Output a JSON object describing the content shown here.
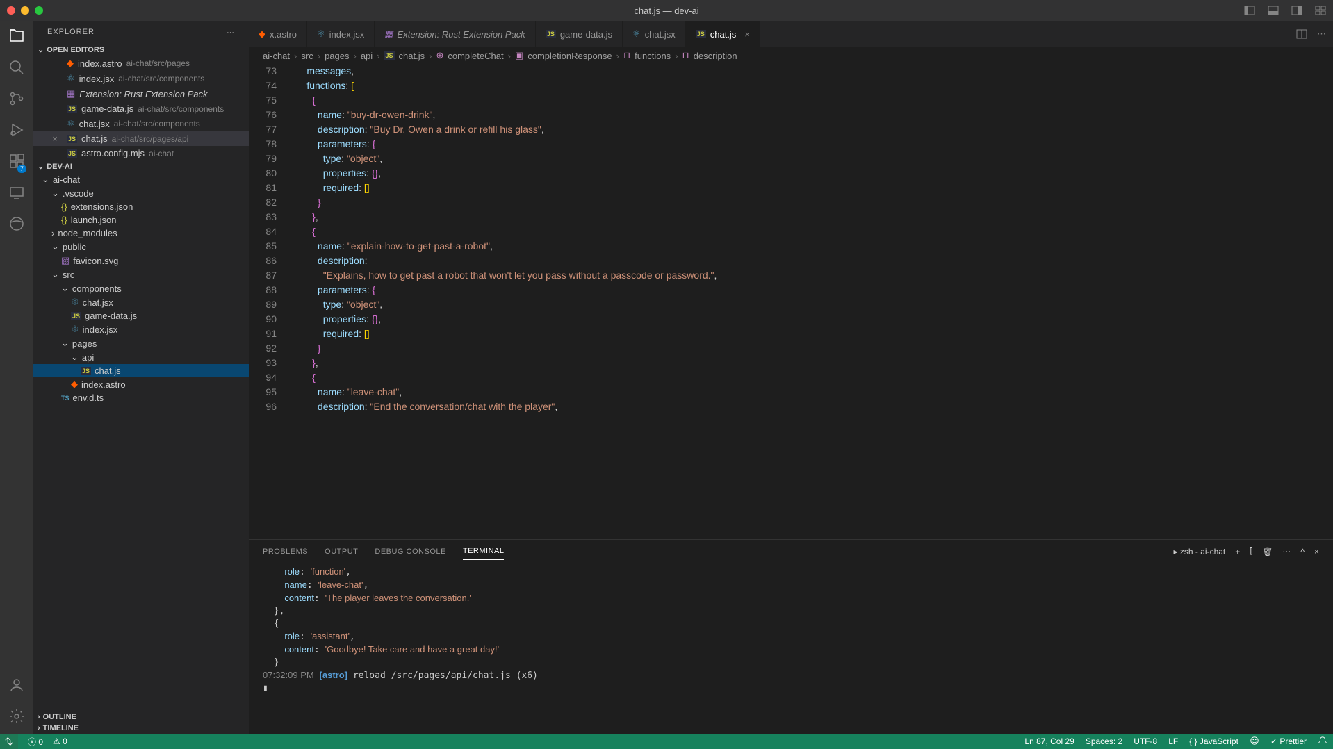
{
  "window": {
    "title": "chat.js — dev-ai"
  },
  "sidebar": {
    "header": "EXPLORER",
    "sections": {
      "openEditors": "OPEN EDITORS",
      "project": "DEV-AI",
      "outline": "OUTLINE",
      "timeline": "TIMELINE"
    },
    "openEditors": [
      {
        "name": "index.astro",
        "path": "ai-chat/src/pages",
        "icon": "astro"
      },
      {
        "name": "index.jsx",
        "path": "ai-chat/src/components",
        "icon": "react"
      },
      {
        "name": "Extension: Rust Extension Pack",
        "path": "",
        "icon": "ext",
        "italic": true
      },
      {
        "name": "game-data.js",
        "path": "ai-chat/src/components",
        "icon": "js"
      },
      {
        "name": "chat.jsx",
        "path": "ai-chat/src/components",
        "icon": "react"
      },
      {
        "name": "chat.js",
        "path": "ai-chat/src/pages/api",
        "icon": "js",
        "active": true
      },
      {
        "name": "astro.config.mjs",
        "path": "ai-chat",
        "icon": "js"
      }
    ],
    "tree": [
      {
        "depth": 0,
        "name": "ai-chat",
        "type": "folder-open"
      },
      {
        "depth": 1,
        "name": ".vscode",
        "type": "folder-open"
      },
      {
        "depth": 2,
        "name": "extensions.json",
        "type": "json"
      },
      {
        "depth": 2,
        "name": "launch.json",
        "type": "json"
      },
      {
        "depth": 1,
        "name": "node_modules",
        "type": "folder"
      },
      {
        "depth": 1,
        "name": "public",
        "type": "folder-open"
      },
      {
        "depth": 2,
        "name": "favicon.svg",
        "type": "svg"
      },
      {
        "depth": 1,
        "name": "src",
        "type": "folder-open"
      },
      {
        "depth": 2,
        "name": "components",
        "type": "folder-open"
      },
      {
        "depth": 3,
        "name": "chat.jsx",
        "type": "react"
      },
      {
        "depth": 3,
        "name": "game-data.js",
        "type": "js"
      },
      {
        "depth": 3,
        "name": "index.jsx",
        "type": "react"
      },
      {
        "depth": 2,
        "name": "pages",
        "type": "folder-open"
      },
      {
        "depth": 3,
        "name": "api",
        "type": "folder-open"
      },
      {
        "depth": 4,
        "name": "chat.js",
        "type": "js",
        "selected": true
      },
      {
        "depth": 3,
        "name": "index.astro",
        "type": "astro"
      },
      {
        "depth": 2,
        "name": "env.d.ts",
        "type": "ts"
      }
    ]
  },
  "tabs": [
    {
      "label": "x.astro",
      "icon": "astro"
    },
    {
      "label": "index.jsx",
      "icon": "react"
    },
    {
      "label": "Extension: Rust Extension Pack",
      "icon": "ext",
      "italic": true
    },
    {
      "label": "game-data.js",
      "icon": "js"
    },
    {
      "label": "chat.jsx",
      "icon": "react"
    },
    {
      "label": "chat.js",
      "icon": "js",
      "active": true
    }
  ],
  "breadcrumbs": [
    "ai-chat",
    "src",
    "pages",
    "api",
    "chat.js",
    "completeChat",
    "completionResponse",
    "functions",
    "description"
  ],
  "code": {
    "startLine": 73,
    "lines": [
      "      messages,",
      "      functions: [",
      "        {",
      "          name: \"buy-dr-owen-drink\",",
      "          description: \"Buy Dr. Owen a drink or refill his glass\",",
      "          parameters: {",
      "            type: \"object\",",
      "            properties: {},",
      "            required: []",
      "          }",
      "        },",
      "        {",
      "          name: \"explain-how-to-get-past-a-robot\",",
      "          description:",
      "            \"Explains, how to get past a robot that won't let you pass without a passcode or password.\",",
      "          parameters: {",
      "            type: \"object\",",
      "            properties: {},",
      "            required: []",
      "          }",
      "        },",
      "        {",
      "          name: \"leave-chat\",",
      "          description: \"End the conversation/chat with the player\","
    ]
  },
  "panel": {
    "tabs": [
      "PROBLEMS",
      "OUTPUT",
      "DEBUG CONSOLE",
      "TERMINAL"
    ],
    "activeTab": 3,
    "terminalLabel": "zsh - ai-chat",
    "terminal": [
      "    role: 'function',",
      "    name: 'leave-chat',",
      "    content: 'The player leaves the conversation.'",
      "  },",
      "  {",
      "    role: 'assistant',",
      "    content: 'Goodbye! Take care and have a great day!'",
      "  }",
      "07:32:09 PM [astro] reload /src/pages/api/chat.js (x6)",
      "▮"
    ]
  },
  "statusbar": {
    "errors": "0",
    "warnings": "0",
    "cursor": "Ln 87, Col 29",
    "spaces": "Spaces: 2",
    "encoding": "UTF-8",
    "eol": "LF",
    "lang": "JavaScript",
    "prettier": "Prettier"
  },
  "activitybadge": "7"
}
